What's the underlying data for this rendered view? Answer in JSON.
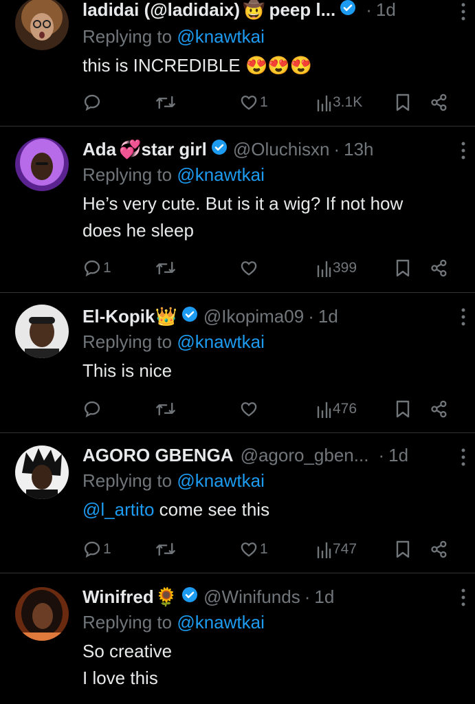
{
  "replying_label": "Replying to",
  "tweets": [
    {
      "name": "ladidai (@ladidaix)",
      "name_emoji": "🤠",
      "name_suffix": "peep l...",
      "handle": "",
      "time": "1d",
      "reply_to": "@knawtkai",
      "body_lines": [
        "this is INCREDIBLE 😍😍😍"
      ],
      "replies": "",
      "retweets": "",
      "likes": "1",
      "views": "3.1K",
      "avatar_color": "#c89b7b"
    },
    {
      "name": "Ada",
      "name_emoji": "💞",
      "name_suffix": "star girl",
      "handle": "@Oluchisxn",
      "time": "13h",
      "reply_to": "@knawtkai",
      "body_lines": [
        "He’s very cute. But is it a wig? If not how",
        "does he sleep"
      ],
      "replies": "1",
      "retweets": "",
      "likes": "",
      "views": "399",
      "avatar_color": "#a24ad8"
    },
    {
      "name": "El-Kopik",
      "name_emoji": "👑",
      "name_suffix": "",
      "handle": "@Ikopima09",
      "time": "1d",
      "reply_to": "@knawtkai",
      "body_lines": [
        "This is nice"
      ],
      "replies": "",
      "retweets": "",
      "likes": "",
      "views": "476",
      "avatar_color": "#d8d8d8"
    },
    {
      "name": "AGORO GBENGA",
      "name_emoji": "",
      "name_suffix": "",
      "handle": "@agoro_gben...",
      "time": "1d",
      "reply_to": "@knawtkai",
      "body_mention": "@l_artito",
      "body_lines": [
        " come see this"
      ],
      "replies": "1",
      "retweets": "",
      "likes": "1",
      "views": "747",
      "avatar_color": "#e4e4e4"
    },
    {
      "name": "Winifred",
      "name_emoji": "🌻",
      "name_suffix": "",
      "handle": "@Winifunds",
      "time": "1d",
      "reply_to": "@knawtkai",
      "body_lines": [
        "So creative",
        "I love this"
      ],
      "replies": "",
      "retweets": "",
      "likes": "",
      "views": "",
      "avatar_color": "#e07a3c"
    }
  ],
  "colors": {
    "background": "#000000",
    "text": "#e7e9ea",
    "muted": "#71767b",
    "link": "#1d9bf0",
    "verified": "#1d9bf0"
  },
  "icons": [
    "reply-icon",
    "retweet-icon",
    "like-icon",
    "views-icon",
    "bookmark-icon",
    "share-icon",
    "more-icon",
    "verified-icon"
  ]
}
